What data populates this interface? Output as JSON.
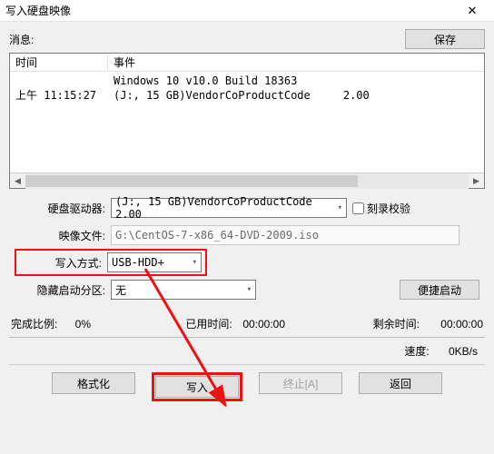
{
  "window": {
    "title": "写入硬盘映像"
  },
  "msg": {
    "label": "消息:",
    "save": "保存"
  },
  "log": {
    "header_time": "时间",
    "header_event": "事件",
    "row1_time": "",
    "row1_event": "Windows 10 v10.0 Build 18363",
    "row2_time": "上午 11:15:27",
    "row2_event": "(J:, 15 GB)VendorCoProductCode     2.00"
  },
  "form": {
    "drive_label": "硬盘驱动器:",
    "drive_value": "(J:, 15 GB)VendorCoProductCode     2.00",
    "burn_verify": "刻录校验",
    "image_label": "映像文件:",
    "image_value": "G:\\CentOS-7-x86_64-DVD-2009.iso",
    "mode_label": "写入方式:",
    "mode_value": "USB-HDD+",
    "hide_label": "隐藏启动分区:",
    "hide_value": "无",
    "easyboot": "便捷启动"
  },
  "status": {
    "done_label": "完成比例:",
    "done_value": "0%",
    "elapsed_label": "已用时间:",
    "elapsed_value": "00:00:00",
    "remain_label": "剩余时间:",
    "remain_value": "00:00:00",
    "speed_label": "速度:",
    "speed_value": "0KB/s"
  },
  "buttons": {
    "format": "格式化",
    "write": "写入",
    "abort": "终止[A]",
    "back": "返回"
  }
}
